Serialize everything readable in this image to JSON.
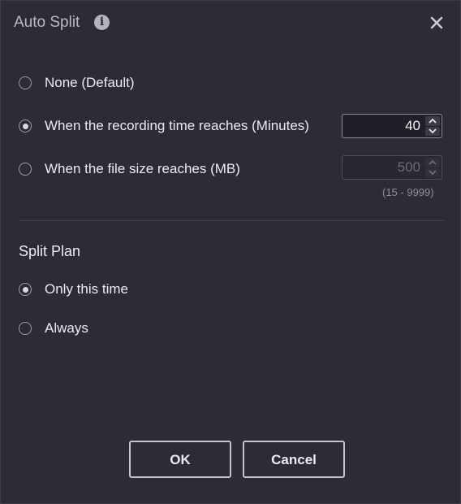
{
  "dialog": {
    "title": "Auto Split",
    "icons": {
      "info": "info-icon",
      "close": "close-icon"
    }
  },
  "split_options": {
    "none_label": "None (Default)",
    "time_label": "When the recording time reaches (Minutes)",
    "time_value": "40",
    "size_label": "When the file size reaches (MB)",
    "size_value": "500",
    "size_range": "(15 - 9999)",
    "selected": "time"
  },
  "split_plan": {
    "title": "Split Plan",
    "once_label": "Only this time",
    "always_label": "Always",
    "selected": "once"
  },
  "buttons": {
    "ok": "OK",
    "cancel": "Cancel"
  },
  "colors": {
    "background": "#2b2c35",
    "text": "#ececf0",
    "muted": "#8e8e98"
  }
}
